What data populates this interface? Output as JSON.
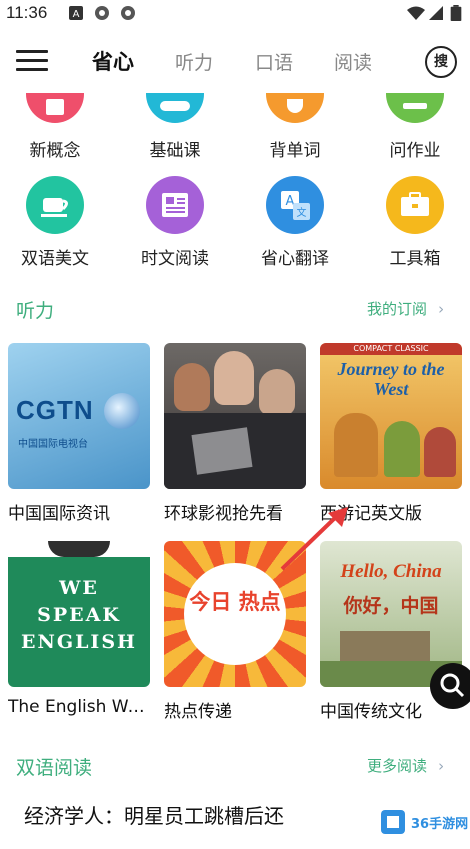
{
  "status_bar": {
    "time": "11:36"
  },
  "header": {
    "tabs": [
      {
        "label": "省心",
        "active": true
      },
      {
        "label": "听力",
        "active": false
      },
      {
        "label": "口语",
        "active": false
      },
      {
        "label": "阅读",
        "active": false
      }
    ],
    "search_label": "搜"
  },
  "icon_grid": {
    "row1": [
      {
        "label": "新概念",
        "color": "#ef4f6b",
        "icon": "book-icon"
      },
      {
        "label": "基础课",
        "color": "#22b8d6",
        "icon": "gamepad-icon"
      },
      {
        "label": "背单词",
        "color": "#f59a2e",
        "icon": "heart-icon"
      },
      {
        "label": "问作业",
        "color": "#6cc04a",
        "icon": "question-icon"
      }
    ],
    "row2": [
      {
        "label": "双语美文",
        "color": "#22c4a0",
        "icon": "cup-icon"
      },
      {
        "label": "时文阅读",
        "color": "#a561d8",
        "icon": "newspaper-icon"
      },
      {
        "label": "省心翻译",
        "color": "#2f8fe0",
        "icon": "translate-icon"
      },
      {
        "label": "工具箱",
        "color": "#f5b81c",
        "icon": "toolbox-icon"
      }
    ]
  },
  "listening": {
    "title": "听力",
    "more": "我的订阅",
    "cards": [
      {
        "title": "中国国际资讯",
        "thumb_text": "CGTN",
        "thumb_sub": "中国国际电视台",
        "bg": "#6fb3e0"
      },
      {
        "title": "环球影视抢先看",
        "thumb_text": "",
        "thumb_sub": "",
        "bg": "#5a5350"
      },
      {
        "title": "西游记英文版",
        "thumb_text": "Journey to the West",
        "thumb_sub": "COMPACT CLASSIC",
        "bg": "#e8a23a"
      },
      {
        "title": "The English We...",
        "thumb_text": "WE SPEAK ENGLISH",
        "thumb_sub": "",
        "bg": "#1f8a5a"
      },
      {
        "title": "热点传递",
        "thumb_text": "今日 热点",
        "thumb_sub": "",
        "bg": "#f05a2a"
      },
      {
        "title": "中国传统文化",
        "thumb_text": "Hello, China",
        "thumb_sub": "你好，中国",
        "bg": "#8cae6a"
      }
    ]
  },
  "bilingual": {
    "title": "双语阅读",
    "more": "更多阅读",
    "article_title": "经济学人：明星员工跳槽后还"
  }
}
